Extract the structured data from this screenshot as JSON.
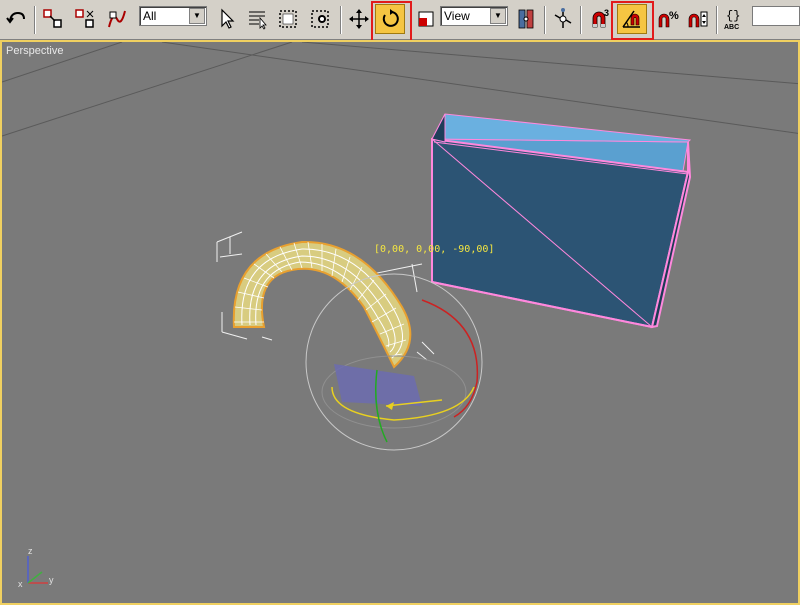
{
  "toolbar": {
    "buttons": [
      {
        "name": "undo-redo-icon"
      },
      {
        "name": "select-and-link-icon"
      },
      {
        "name": "unlink-selection-icon"
      },
      {
        "name": "bind-to-space-warp-icon"
      },
      {
        "name": "select-object-icon"
      },
      {
        "name": "select-by-name-icon"
      },
      {
        "name": "rectangular-selection-region-icon"
      },
      {
        "name": "window-crossing-icon"
      },
      {
        "name": "select-and-move-icon"
      },
      {
        "name": "select-and-rotate-icon",
        "active": true,
        "highlighted": true
      },
      {
        "name": "select-and-scale-icon"
      },
      {
        "name": "use-pivot-center-icon"
      },
      {
        "name": "select-and-manipulate-icon"
      },
      {
        "name": "snaps-toggle-icon",
        "label": "3"
      },
      {
        "name": "angle-snap-toggle-icon",
        "active": true,
        "highlighted": true
      },
      {
        "name": "percent-snap-toggle-icon",
        "label": "%"
      },
      {
        "name": "spinner-snap-toggle-icon"
      },
      {
        "name": "edit-named-selection-sets-icon",
        "label": "ABC"
      }
    ],
    "selection_filter": "All",
    "reference_coord_system": "View"
  },
  "viewport": {
    "label": "Perspective",
    "rotation_readout": "[0,00, 0,00, -90,00]",
    "axis_labels": {
      "z": "z",
      "x": "x",
      "y": "y"
    }
  },
  "colors": {
    "toolbar_bg": "#d4d0c8",
    "active_button": "#f5c542",
    "highlight_box": "#e21b1b",
    "viewport_bg": "#7a7a7a",
    "active_viewport_border": "#f0d060",
    "box_face": "#2e5a7a",
    "box_wire": "#ff88dd",
    "torus_wire": "#f0e8b0",
    "gizmo_red": "#cc2222",
    "gizmo_green": "#22aa22",
    "gizmo_yellow": "#e8d020"
  }
}
